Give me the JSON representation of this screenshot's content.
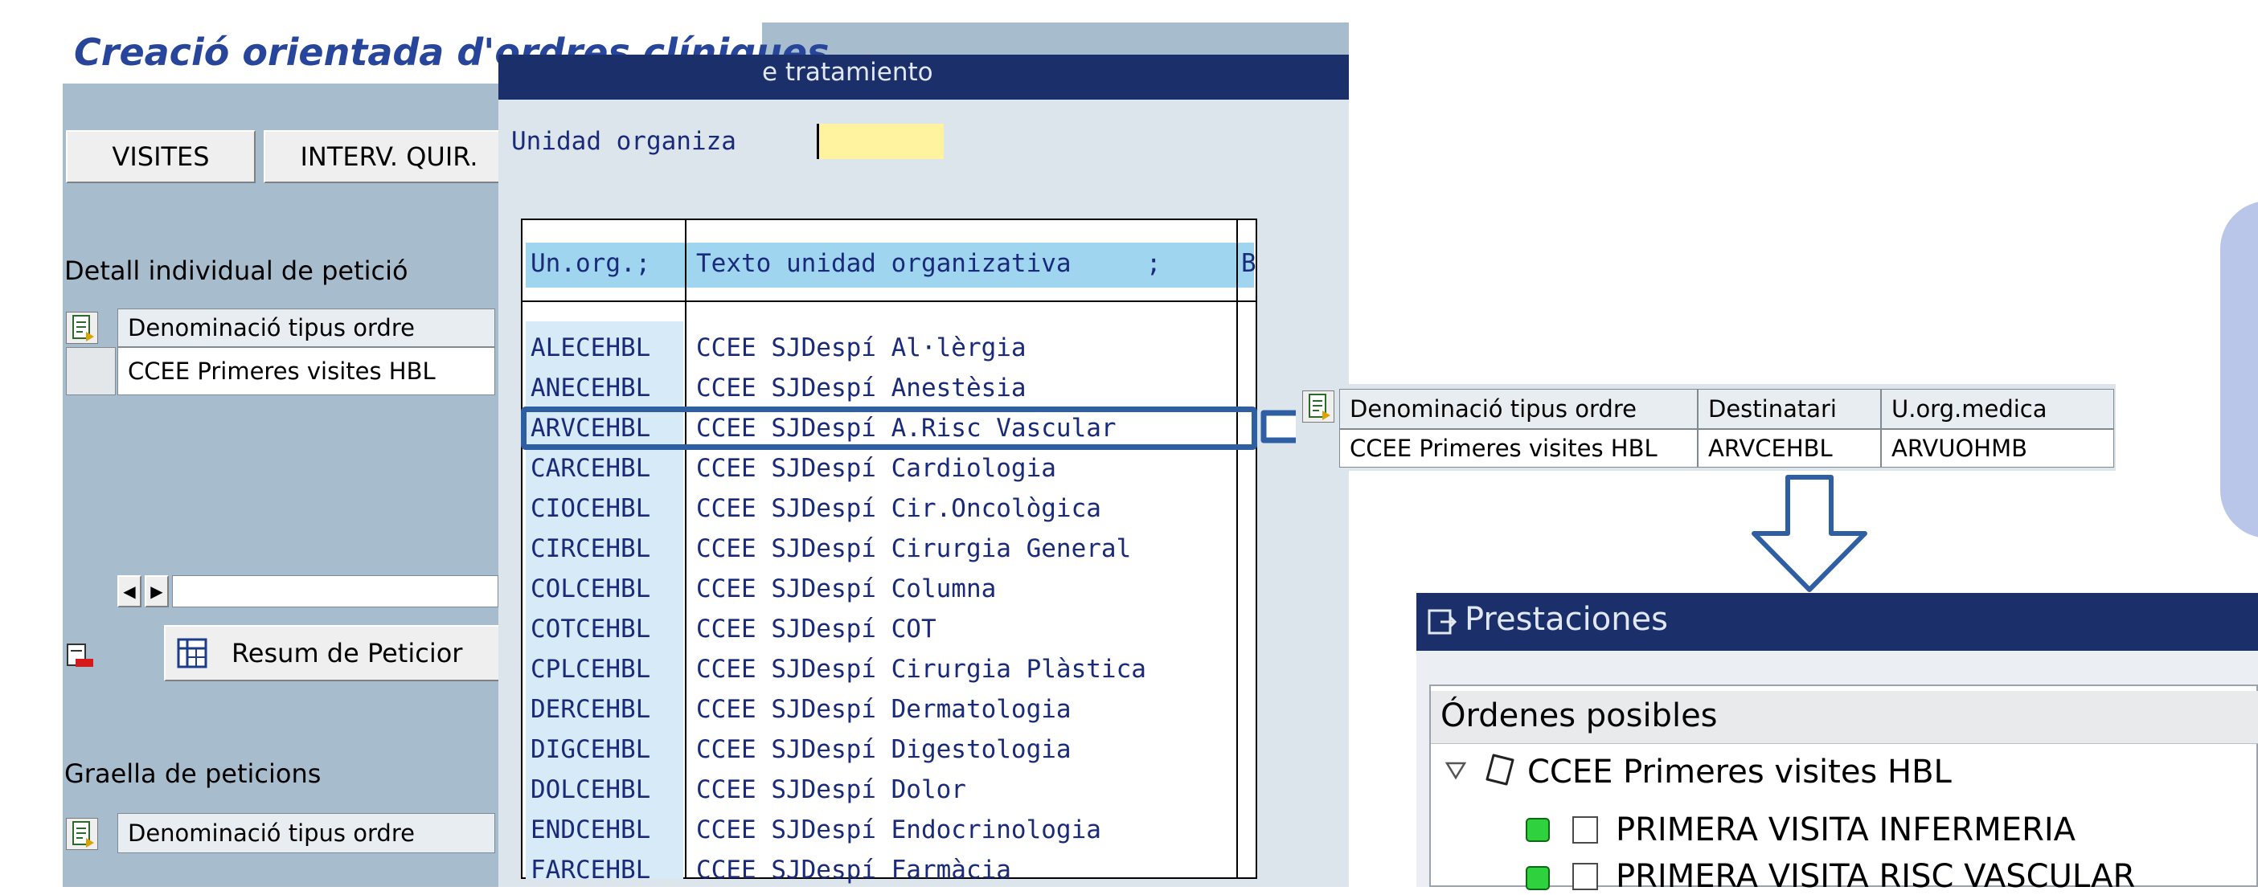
{
  "window": {
    "title": "Creació orientada d'ordres clíniques"
  },
  "left": {
    "buttons": {
      "visites": "VISITES",
      "interv_quir": "INTERV. QUIR."
    },
    "detail_section": "Detall individual de petició",
    "detail_table": {
      "header": "Denominació tipus ordre",
      "row": "CCEE Primeres visites HBL"
    },
    "resum_button": "Resum de Peticior",
    "grid_section": "Graella de peticions",
    "grid_table": {
      "header": "Denominació tipus ordre"
    }
  },
  "popup": {
    "title": "e tratamiento",
    "field_label": "Unidad organiza",
    "field_value": "",
    "columns": {
      "code": "Un.org.;",
      "text": "Texto unidad organizativa     ;",
      "extra": "B"
    },
    "rows": [
      {
        "code": "ALECEHBL",
        "text": "CCEE SJDespí Al·lèrgia"
      },
      {
        "code": "ANECEHBL",
        "text": "CCEE SJDespí Anestèsia"
      },
      {
        "code": "ARVCEHBL",
        "text": "CCEE SJDespí A.Risc Vascular"
      },
      {
        "code": "CARCEHBL",
        "text": "CCEE SJDespí Cardiologia"
      },
      {
        "code": "CIOCEHBL",
        "text": "CCEE SJDespí Cir.Oncològica"
      },
      {
        "code": "CIRCEHBL",
        "text": "CCEE SJDespí Cirurgia General"
      },
      {
        "code": "COLCEHBL",
        "text": "CCEE SJDespí Columna"
      },
      {
        "code": "COTCEHBL",
        "text": "CCEE SJDespí COT"
      },
      {
        "code": "CPLCEHBL",
        "text": "CCEE SJDespí Cirurgia Plàstica"
      },
      {
        "code": "DERCEHBL",
        "text": "CCEE SJDespí Dermatologia"
      },
      {
        "code": "DIGCEHBL",
        "text": "CCEE SJDespí Digestologia"
      },
      {
        "code": "DOLCEHBL",
        "text": "CCEE SJDespí Dolor"
      },
      {
        "code": "ENDCEHBL",
        "text": "CCEE SJDespí Endocrinologia"
      },
      {
        "code": "FARCEHBL",
        "text": "CCEE SJDespí Farmàcia"
      }
    ]
  },
  "result_table": {
    "headers": [
      "Denominació tipus ordre",
      "Destinatari",
      "U.org.medica"
    ],
    "row": [
      "CCEE Primeres visites HBL",
      "ARVCEHBL",
      "ARVUOHMB"
    ]
  },
  "prestaciones": {
    "title": "Prestaciones",
    "section_header": "Órdenes posibles",
    "folder": "CCEE Primeres visites HBL",
    "items": [
      "PRIMERA VISITA INFERMERIA",
      "PRIMERA VISITA RISC VASCULAR"
    ]
  },
  "colors": {
    "sap_blue": "#a7bccd",
    "title_bar": "#1b2f6b",
    "highlight": "#2f5fa3",
    "arrow": "#2f5fa3",
    "status_green": "#2fd13f"
  },
  "icons": [
    "document-icon",
    "grid-icon",
    "scroll-left-icon",
    "scroll-right-icon",
    "delete-icon",
    "window-icon",
    "triangle-down-icon",
    "folder-icon"
  ]
}
